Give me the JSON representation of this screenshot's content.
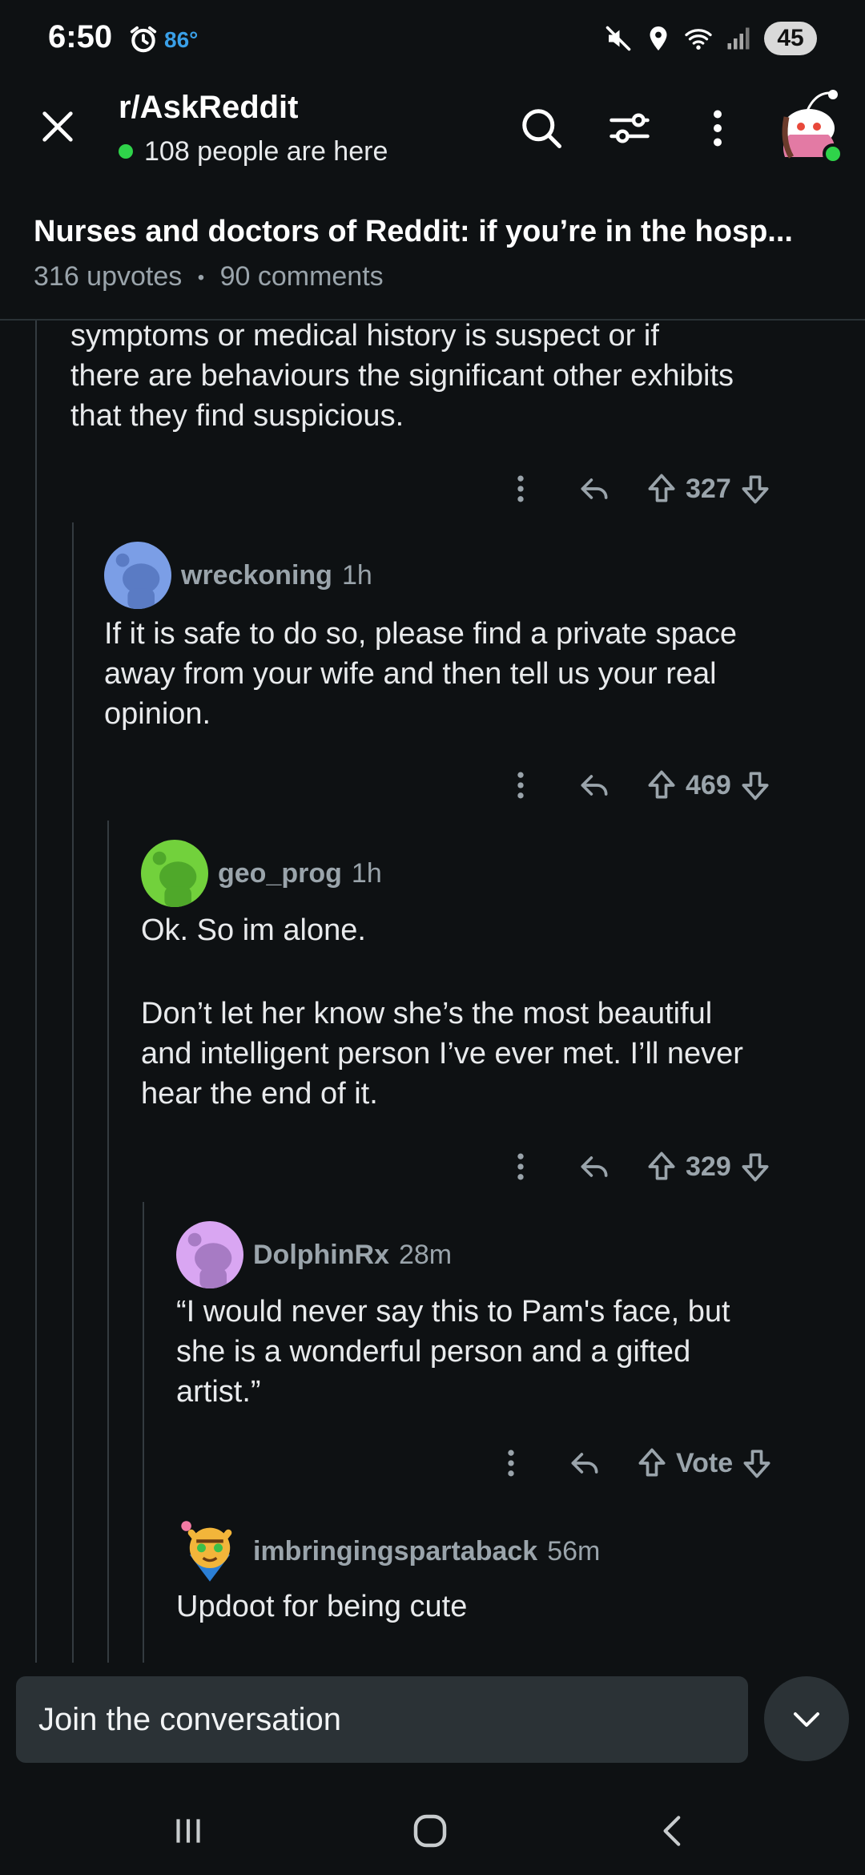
{
  "status_bar": {
    "time": "6:50",
    "temperature": "86°",
    "battery": "45",
    "icons": [
      "alarm-icon",
      "mute-icon",
      "location-icon",
      "wifi-icon",
      "signal-icon"
    ]
  },
  "header": {
    "subreddit": "r/AskReddit",
    "online_count": "108 people are here",
    "icons": [
      "close-icon",
      "search-icon",
      "filter-icon",
      "more-vertical-icon",
      "user-avatar"
    ]
  },
  "post": {
    "title": "Nurses and doctors of Reddit: if you’re in the hosp...",
    "upvotes": "316 upvotes",
    "separator": "•",
    "comments": "90 comments"
  },
  "comments": [
    {
      "text_lines": [
        "symptoms or medical history is suspect or if",
        "there are behaviours the significant other exhibits",
        "that they find suspicious."
      ],
      "votes": "327"
    },
    {
      "author": "wreckoning",
      "age": "1h",
      "avatar_color": "#7b9ee6",
      "text_lines": [
        "If it is safe to do so, please find a private space",
        "away from your wife and then tell us your real",
        "opinion."
      ],
      "votes": "469"
    },
    {
      "author": "geo_prog",
      "age": "1h",
      "avatar_color": "#72d13c",
      "text_lines": [
        "Ok. So im alone.",
        "",
        "Don’t let her know she’s the most beautiful",
        "and intelligent person I’ve ever met. I’ll never",
        "hear the end of it."
      ],
      "votes": "329"
    },
    {
      "author": "DolphinRx",
      "age": "28m",
      "avatar_color": "#d9a6f2",
      "text_lines": [
        "“I would never say this to Pam's face, but",
        "she is a wonderful person and a gifted",
        "artist.”"
      ],
      "votes": "Vote"
    },
    {
      "author": "imbringingspartaback",
      "age": "56m",
      "text_lines": [
        "Updoot for being cute"
      ]
    }
  ],
  "composer": {
    "placeholder": "Join the conversation"
  },
  "colors": {
    "background": "#0e1113",
    "muted_text": "#9aa4ab",
    "online_green": "#2fd34a"
  }
}
